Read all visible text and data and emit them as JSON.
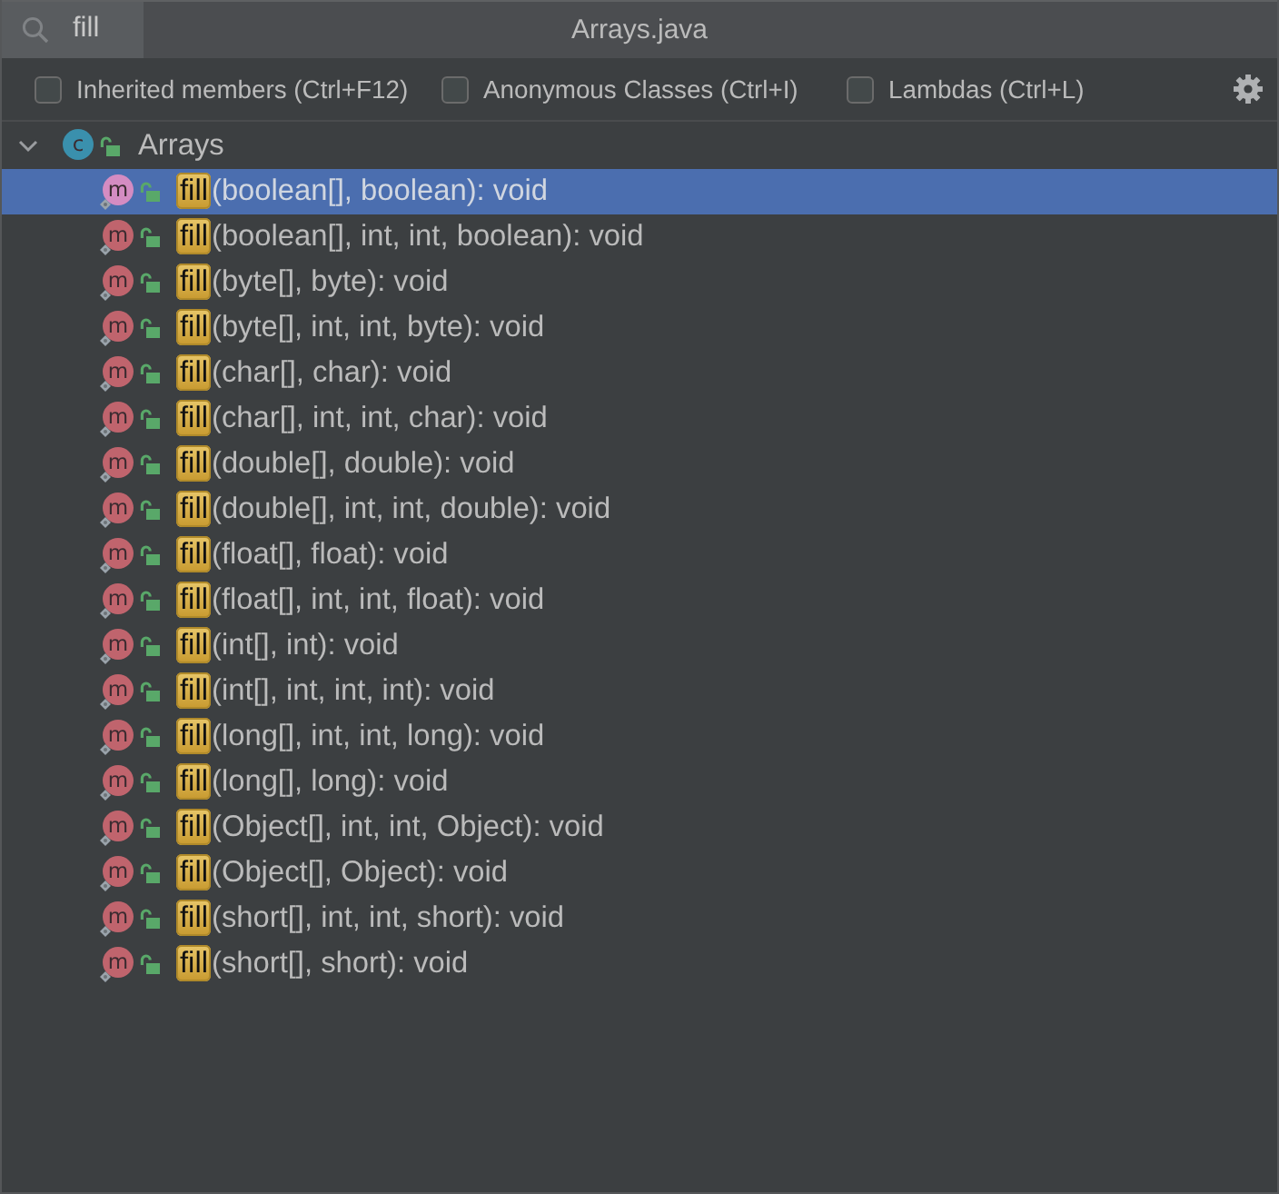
{
  "search": {
    "value": "fill"
  },
  "window": {
    "title": "Arrays.java"
  },
  "filters": [
    {
      "label": "Inherited members (Ctrl+F12)",
      "checked": false
    },
    {
      "label": "Anonymous Classes (Ctrl+I)",
      "checked": false
    },
    {
      "label": "Lambdas (Ctrl+L)",
      "checked": false
    }
  ],
  "tree": {
    "badge": "c",
    "label": "Arrays",
    "expanded": true,
    "children": [
      {
        "badge": "m",
        "name": "fill",
        "signature": "(boolean[], boolean): void",
        "highlighted": true,
        "selected": true
      },
      {
        "badge": "m",
        "name": "fill",
        "signature": "(boolean[], int, int, boolean): void",
        "highlighted": true,
        "selected": false
      },
      {
        "badge": "m",
        "name": "fill",
        "signature": "(byte[], byte): void",
        "highlighted": true,
        "selected": false
      },
      {
        "badge": "m",
        "name": "fill",
        "signature": "(byte[], int, int, byte): void",
        "highlighted": true,
        "selected": false
      },
      {
        "badge": "m",
        "name": "fill",
        "signature": "(char[], char): void",
        "highlighted": true,
        "selected": false
      },
      {
        "badge": "m",
        "name": "fill",
        "signature": "(char[], int, int, char): void",
        "highlighted": true,
        "selected": false
      },
      {
        "badge": "m",
        "name": "fill",
        "signature": "(double[], double): void",
        "highlighted": true,
        "selected": false
      },
      {
        "badge": "m",
        "name": "fill",
        "signature": "(double[], int, int, double): void",
        "highlighted": true,
        "selected": false
      },
      {
        "badge": "m",
        "name": "fill",
        "signature": "(float[], float): void",
        "highlighted": true,
        "selected": false
      },
      {
        "badge": "m",
        "name": "fill",
        "signature": "(float[], int, int, float): void",
        "highlighted": true,
        "selected": false
      },
      {
        "badge": "m",
        "name": "fill",
        "signature": "(int[], int): void",
        "highlighted": true,
        "selected": false
      },
      {
        "badge": "m",
        "name": "fill",
        "signature": "(int[], int, int, int): void",
        "highlighted": true,
        "selected": false
      },
      {
        "badge": "m",
        "name": "fill",
        "signature": "(long[], int, int, long): void",
        "highlighted": true,
        "selected": false
      },
      {
        "badge": "m",
        "name": "fill",
        "signature": "(long[], long): void",
        "highlighted": true,
        "selected": false
      },
      {
        "badge": "m",
        "name": "fill",
        "signature": "(Object[], int, int, Object): void",
        "highlighted": true,
        "selected": false
      },
      {
        "badge": "m",
        "name": "fill",
        "signature": "(Object[], Object): void",
        "highlighted": true,
        "selected": false
      },
      {
        "badge": "m",
        "name": "fill",
        "signature": "(short[], int, int, short): void",
        "highlighted": true,
        "selected": false
      },
      {
        "badge": "m",
        "name": "fill",
        "signature": "(short[], short): void",
        "highlighted": true,
        "selected": false
      }
    ]
  }
}
